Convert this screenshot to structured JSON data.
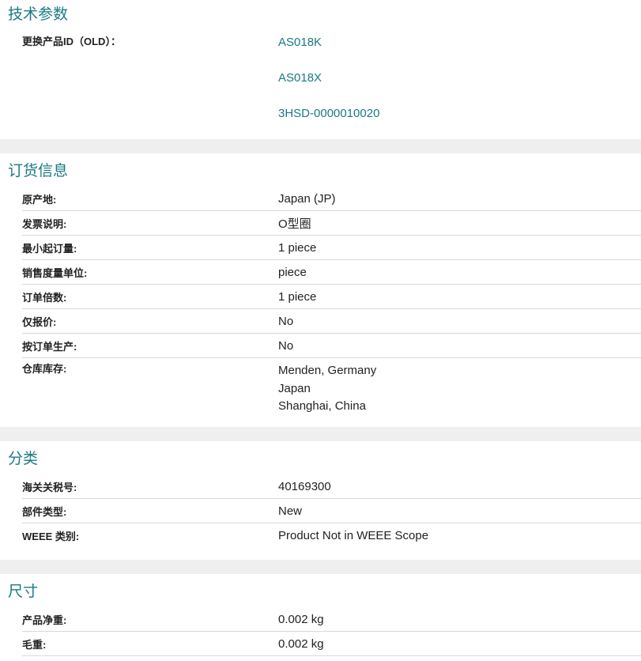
{
  "technical": {
    "title": "技术参数",
    "replaced_label": "更换产品ID（OLD）：",
    "replaced_values": [
      "AS018K",
      "AS018X",
      "3HSD-0000010020"
    ]
  },
  "ordering": {
    "title": "订货信息",
    "rows": [
      {
        "label": "原产地:",
        "value": "Japan (JP)"
      },
      {
        "label": "发票说明:",
        "value": "O型圈"
      },
      {
        "label": "最小起订量:",
        "value": "1 piece"
      },
      {
        "label": "销售度量单位:",
        "value": "piece"
      },
      {
        "label": "订单倍数:",
        "value": "1 piece"
      },
      {
        "label": "仅报价:",
        "value": "No"
      },
      {
        "label": "按订单生产:",
        "value": "No"
      }
    ],
    "warehouse_label": "仓库库存:",
    "warehouse_values": [
      "Menden, Germany",
      "Japan",
      "Shanghai, China"
    ]
  },
  "classification": {
    "title": "分类",
    "rows": [
      {
        "label": "海关关税号:",
        "value": "40169300"
      },
      {
        "label": "部件类型:",
        "value": "New"
      },
      {
        "label": "WEEE 类别:",
        "value": "Product Not in WEEE Scope"
      }
    ]
  },
  "dimensions": {
    "title": "尺寸",
    "rows": [
      {
        "label": "产品净重:",
        "value": "0.002 kg"
      },
      {
        "label": "毛重:",
        "value": "0.002 kg"
      }
    ]
  },
  "colors": {
    "accent": "#1a7a82",
    "divider": "#d8d8d8",
    "gap": "#efefef"
  }
}
